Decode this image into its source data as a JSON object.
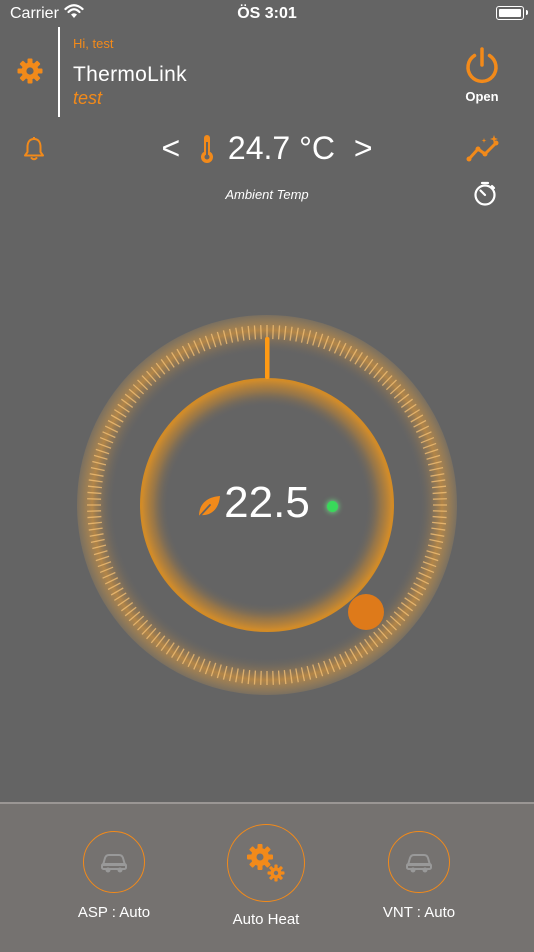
{
  "status_bar": {
    "carrier": "Carrier",
    "time": "ÖS 3:01"
  },
  "header": {
    "greeting": "Hi, test",
    "app_name": "ThermoLink",
    "user_name": "test",
    "power_label": "Open"
  },
  "ambient": {
    "prev": "<",
    "next": ">",
    "value": "24.7 °C",
    "label": "Ambient Temp"
  },
  "dial": {
    "setpoint": "22.5",
    "status": "active"
  },
  "bottom": {
    "asp_label": "ASP : Auto",
    "heat_label": "Auto Heat",
    "vnt_label": "VNT : Auto"
  },
  "colors": {
    "accent": "#f28a1a",
    "background": "#646464",
    "bottom_bar": "#757270",
    "status_dot": "#39d95a"
  },
  "icons": [
    "wifi-icon",
    "battery-icon",
    "gear-icon",
    "power-icon",
    "bell-icon",
    "thermometer-icon",
    "chart-sparkle-icon",
    "timer-icon",
    "leaf-icon",
    "car-icon",
    "gears-icon"
  ]
}
